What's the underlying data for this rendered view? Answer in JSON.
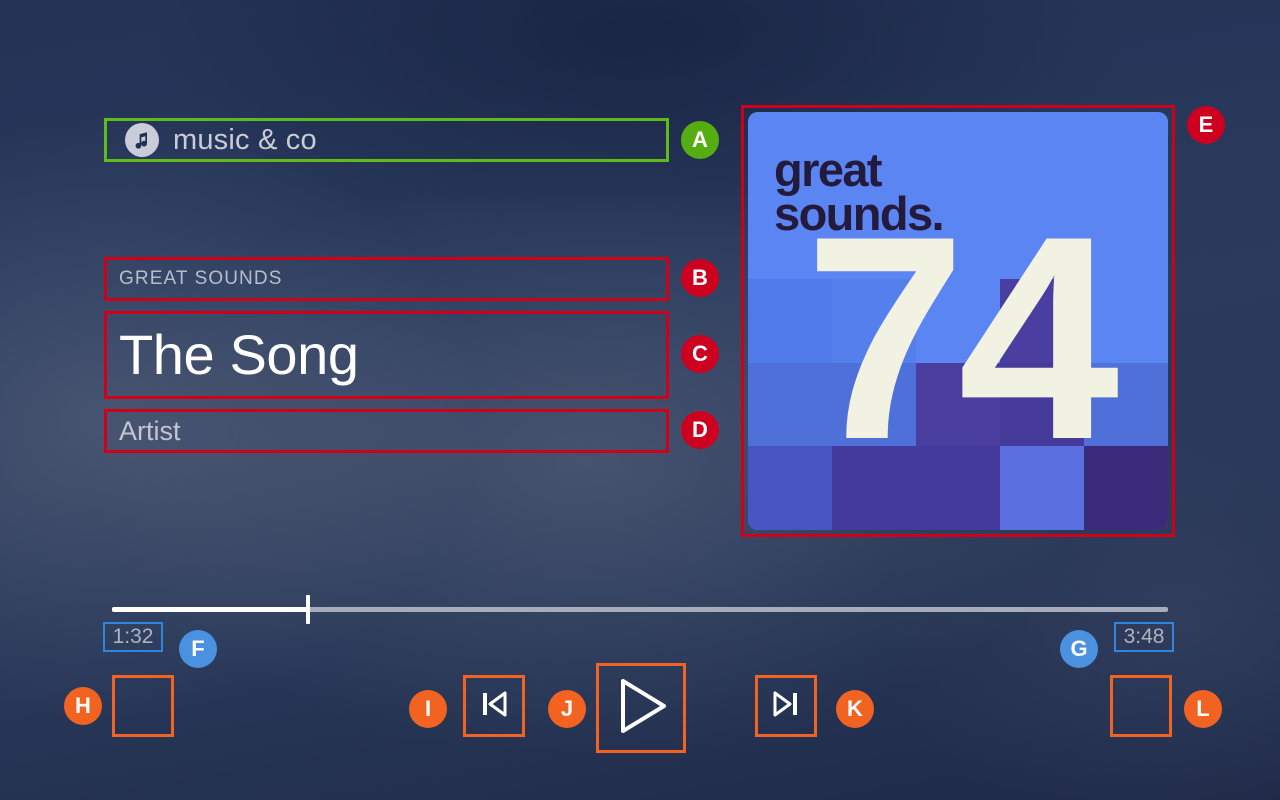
{
  "app": {
    "brand_name": "music & co",
    "brand_icon": "music-note-icon"
  },
  "now_playing": {
    "album_label": "GREAT SOUNDS",
    "track_title": "The Song",
    "artist": "Artist",
    "album_art": {
      "wordmark_line1": "great",
      "wordmark_line2": "sounds.",
      "number": "74",
      "colors": {
        "base_blue": "#5a85f2",
        "mid_blue": "#4f6fd9",
        "deep_purple": "#4a3fa0",
        "darkest_purple": "#3b2a7a",
        "number_cream": "#f2f2e2",
        "wordmark_ink": "#241a3c"
      }
    }
  },
  "playback": {
    "elapsed": "1:32",
    "duration": "3:48",
    "progress_percent": 18.6
  },
  "controls": {
    "shuffle_label": "",
    "previous_label": "previous-track",
    "play_label": "play",
    "next_label": "next-track",
    "repeat_label": ""
  },
  "annotations": [
    {
      "id": "A",
      "color": "#55ad12",
      "target": "brand-header"
    },
    {
      "id": "B",
      "color": "#ce0020",
      "target": "album-label"
    },
    {
      "id": "C",
      "color": "#ce0020",
      "target": "track-title"
    },
    {
      "id": "D",
      "color": "#ce0020",
      "target": "artist-name"
    },
    {
      "id": "E",
      "color": "#ce0020",
      "target": "album-art"
    },
    {
      "id": "F",
      "color": "#4a92e0",
      "target": "elapsed-time"
    },
    {
      "id": "G",
      "color": "#4a92e0",
      "target": "duration-time"
    },
    {
      "id": "H",
      "color": "#f26321",
      "target": "shuffle-button"
    },
    {
      "id": "I",
      "color": "#f26321",
      "target": "previous-button"
    },
    {
      "id": "J",
      "color": "#f26321",
      "target": "play-button"
    },
    {
      "id": "K",
      "color": "#f26321",
      "target": "next-button"
    },
    {
      "id": "L",
      "color": "#f26321",
      "target": "repeat-button"
    }
  ],
  "theme": {
    "accent_green": "#5fbb17",
    "accent_red": "#d10019",
    "accent_blue": "#2f86e0",
    "accent_orange": "#f26321",
    "background_navy": "#273a5e"
  }
}
